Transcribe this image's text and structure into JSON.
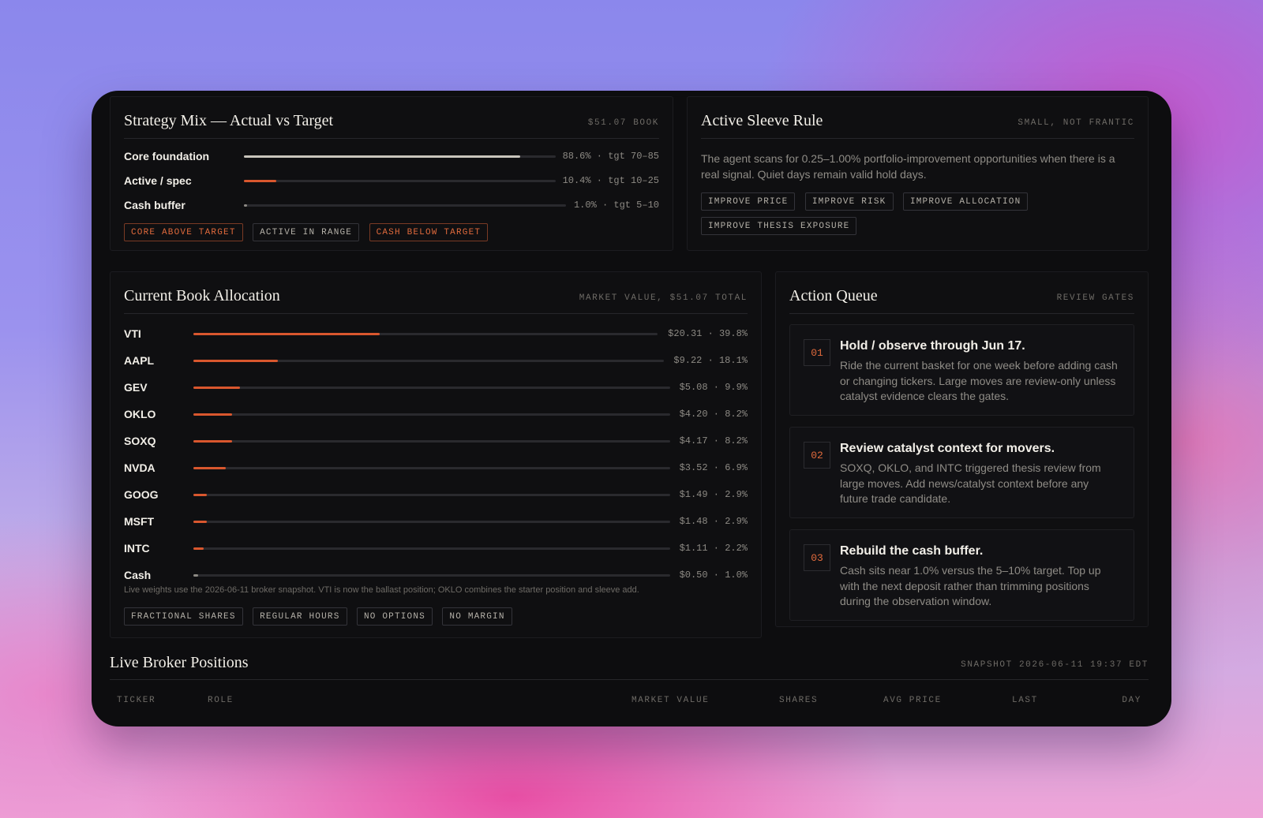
{
  "colors": {
    "accent": "#d9572e",
    "neutral_bar": "#c8c4bb",
    "cash_bar": "#8d8a84"
  },
  "strategy": {
    "title": "Strategy Mix — Actual vs Target",
    "meta": "$51.07 BOOK",
    "rows": [
      {
        "label": "Core foundation",
        "value": "88.6% · tgt 70–85",
        "pct": 88.6
      },
      {
        "label": "Active / spec",
        "value": "10.4% · tgt 10–25",
        "pct": 10.4
      },
      {
        "label": "Cash buffer",
        "value": "1.0% · tgt 5–10",
        "pct": 1.0
      }
    ],
    "tags": [
      "CORE ABOVE TARGET",
      "ACTIVE IN RANGE",
      "CASH BELOW TARGET"
    ]
  },
  "sleeve": {
    "title": "Active Sleeve Rule",
    "meta": "SMALL, NOT FRANTIC",
    "body": "The agent scans for 0.25–1.00% portfolio-improvement opportunities when there is a real signal. Quiet days remain valid hold days.",
    "tags": [
      "IMPROVE PRICE",
      "IMPROVE RISK",
      "IMPROVE ALLOCATION",
      "IMPROVE THESIS EXPOSURE"
    ]
  },
  "allocation": {
    "title": "Current Book Allocation",
    "meta": "MARKET VALUE, $51.07 TOTAL",
    "rows": [
      {
        "ticker": "VTI",
        "value": "$20.31 · 39.8%",
        "pct": 39.8
      },
      {
        "ticker": "AAPL",
        "value": "$9.22 · 18.1%",
        "pct": 18.1
      },
      {
        "ticker": "GEV",
        "value": "$5.08 · 9.9%",
        "pct": 9.9
      },
      {
        "ticker": "OKLO",
        "value": "$4.20 · 8.2%",
        "pct": 8.2
      },
      {
        "ticker": "SOXQ",
        "value": "$4.17 · 8.2%",
        "pct": 8.2
      },
      {
        "ticker": "NVDA",
        "value": "$3.52 · 6.9%",
        "pct": 6.9
      },
      {
        "ticker": "GOOG",
        "value": "$1.49 · 2.9%",
        "pct": 2.9
      },
      {
        "ticker": "MSFT",
        "value": "$1.48 · 2.9%",
        "pct": 2.9
      },
      {
        "ticker": "INTC",
        "value": "$1.11 · 2.2%",
        "pct": 2.2
      },
      {
        "ticker": "Cash",
        "value": "$0.50 · 1.0%",
        "pct": 1.0
      }
    ],
    "note": "Live weights use the 2026-06-11 broker snapshot. VTI is now the ballast position; OKLO combines the starter position and sleeve add.",
    "tags": [
      "FRACTIONAL SHARES",
      "REGULAR HOURS",
      "NO OPTIONS",
      "NO MARGIN"
    ]
  },
  "queue": {
    "title": "Action Queue",
    "meta": "REVIEW GATES",
    "items": [
      {
        "num": "01",
        "title": "Hold / observe through Jun 17.",
        "desc": "Ride the current basket for one week before adding cash or changing tickers. Large moves are review-only unless catalyst evidence clears the gates."
      },
      {
        "num": "02",
        "title": "Review catalyst context for movers.",
        "desc": "SOXQ, OKLO, and INTC triggered thesis review from large moves. Add news/catalyst context before any future trade candidate."
      },
      {
        "num": "03",
        "title": "Rebuild the cash buffer.",
        "desc": "Cash sits near 1.0% versus the 5–10% target. Top up with the next deposit rather than trimming positions during the observation window."
      }
    ]
  },
  "positions": {
    "title": "Live Broker Positions",
    "meta": "SNAPSHOT 2026-06-11 19:37 EDT",
    "columns": [
      "TICKER",
      "ROLE",
      "MARKET VALUE",
      "SHARES",
      "AVG PRICE",
      "LAST",
      "DAY"
    ]
  }
}
